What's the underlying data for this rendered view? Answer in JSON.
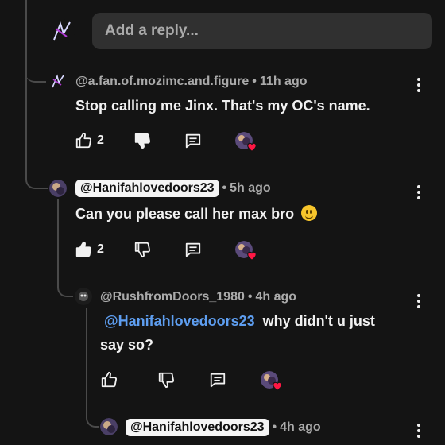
{
  "reply_box": {
    "placeholder": "Add a reply..."
  },
  "comments": [
    {
      "handle": "@a.fan.of.mozimc.and.figure",
      "time": "11h ago",
      "text": "Stop calling me Jinx. That's my OC's name.",
      "likes": "2"
    },
    {
      "handle": "@Hanifahlovedoors23",
      "time": "5h ago",
      "text": "Can you please call her max bro",
      "likes": "2"
    },
    {
      "handle": "@RushfromDoors_1980",
      "time": "4h ago",
      "mention": "@Hanifahlovedoors23",
      "text_line1": "why didn't u just",
      "text_line2": "say so?"
    },
    {
      "handle": "@Hanifahlovedoors23",
      "time": "4h ago"
    }
  ],
  "separator": "•",
  "colors": {
    "background": "#141414",
    "mention": "#5e9ef0",
    "heart": "#ff1744"
  }
}
